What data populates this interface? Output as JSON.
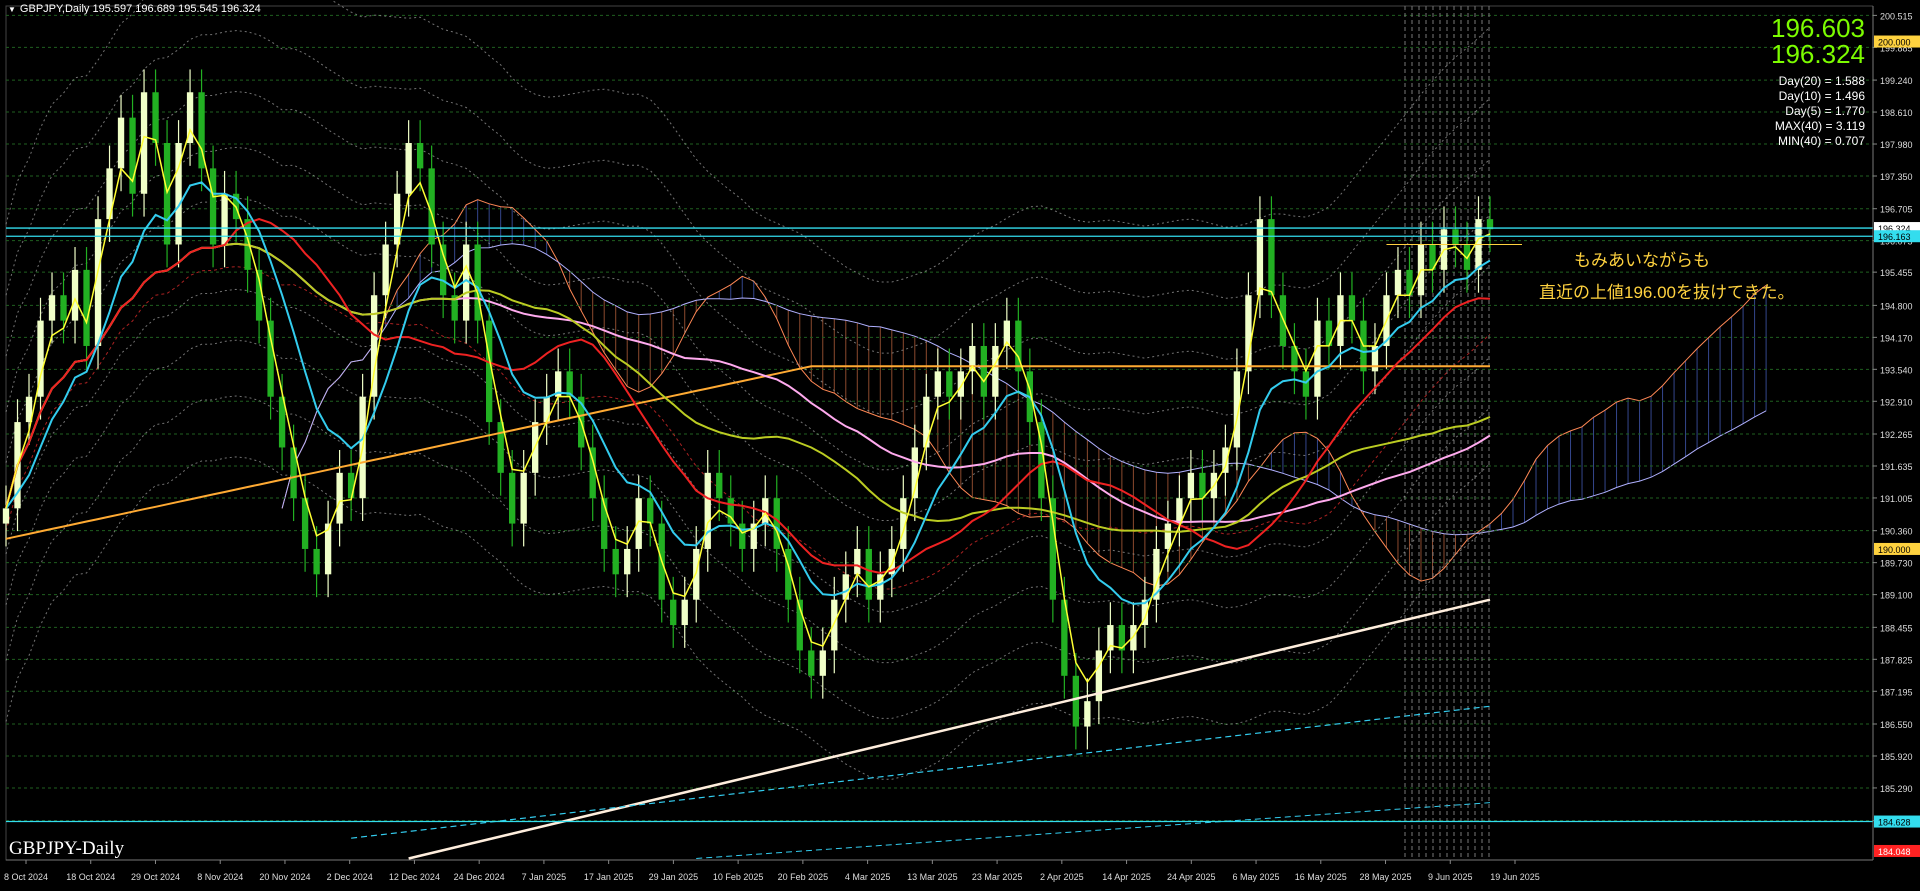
{
  "header": {
    "menu_icon": "down-triangle-icon",
    "text": "GBPJPY,Daily  195.597 196.689 195.545 196.324"
  },
  "symbol_label": "GBPJPY-Daily",
  "prices": {
    "bid": "196.603",
    "ask": "196.324"
  },
  "stats": [
    "Day(20) = 1.588",
    "Day(10) = 1.496",
    "Day(5) = 1.770",
    "MAX(40) = 3.119",
    "MIN(40) = 0.707"
  ],
  "annotation": {
    "line1": "もみあいながらも",
    "line2": "直近の上値196.00を抜けてきた。"
  },
  "colors": {
    "background": "#000000",
    "up_candle": "#F0FFC8",
    "down_candle": "#22B022",
    "ma_yellow": "#FFFF33",
    "ma_cyan": "#33CCEE",
    "ma_red": "#EE2222",
    "ma_pink": "#FFAAEE",
    "ma_olive": "#BBCC22",
    "ma_orange": "#FFAA33",
    "trendline": "#FFEEDD",
    "cloud_bull": "#6080FF",
    "cloud_bear": "#FF8855",
    "hline": "#33DDEE",
    "annotation": "#FFD23F"
  },
  "chart_data": {
    "type": "candlestick",
    "ylim": [
      183.87,
      200.7
    ],
    "x_labels": [
      "8 Oct 2024",
      "18 Oct 2024",
      "29 Oct 2024",
      "8 Nov 2024",
      "20 Nov 2024",
      "2 Dec 2024",
      "12 Dec 2024",
      "24 Dec 2024",
      "7 Jan 2025",
      "17 Jan 2025",
      "29 Jan 2025",
      "10 Feb 2025",
      "20 Feb 2025",
      "4 Mar 2025",
      "13 Mar 2025",
      "23 Mar 2025",
      "2 Apr 2025",
      "14 Apr 2025",
      "24 Apr 2025",
      "6 May 2025",
      "16 May 2025",
      "28 May 2025",
      "9 Jun 2025",
      "19 Jun 2025"
    ],
    "y_ticks": [
      "200.515",
      "199.885",
      "199.240",
      "198.610",
      "197.980",
      "197.350",
      "196.705",
      "196.075",
      "195.455",
      "194.800",
      "194.170",
      "193.540",
      "192.910",
      "192.265",
      "191.635",
      "191.005",
      "190.360",
      "189.730",
      "189.100",
      "188.455",
      "187.825",
      "187.195",
      "186.550",
      "185.920",
      "185.290",
      "184.645"
    ],
    "price_tags": [
      {
        "label": "200.000",
        "value": 200.0
      },
      {
        "label": "196.324",
        "value": 196.324
      },
      {
        "label": "196.163",
        "value": 196.163
      },
      {
        "label": "190.000",
        "value": 190.0
      },
      {
        "label": "184.628",
        "value": 184.628
      },
      {
        "label": "184.048",
        "value": 184.048
      }
    ],
    "horizontal_lines": [
      196.324,
      196.163,
      184.628
    ],
    "resistance_line": 196.0,
    "last_ohlc": {
      "open": 195.597,
      "high": 196.689,
      "low": 195.545,
      "close": 196.324
    },
    "closes": [
      190.8,
      192.5,
      193.0,
      194.5,
      195.0,
      194.5,
      195.5,
      194.0,
      196.5,
      197.5,
      198.5,
      197.0,
      199.0,
      198.0,
      196.0,
      198.0,
      199.0,
      197.5,
      196.0,
      197.0,
      196.5,
      195.5,
      194.5,
      193.0,
      192.0,
      191.0,
      190.0,
      189.5,
      190.5,
      191.5,
      191.0,
      193.0,
      195.0,
      196.0,
      197.0,
      198.0,
      197.5,
      196.0,
      195.0,
      194.5,
      196.0,
      194.5,
      192.5,
      191.5,
      190.5,
      191.5,
      192.5,
      193.0,
      193.5,
      193.0,
      192.0,
      191.0,
      190.0,
      189.5,
      190.0,
      191.0,
      190.5,
      189.0,
      188.5,
      189.0,
      190.0,
      191.5,
      191.0,
      190.5,
      190.0,
      190.5,
      191.0,
      190.0,
      189.0,
      188.0,
      187.5,
      188.0,
      189.0,
      189.5,
      190.0,
      189.0,
      189.5,
      190.0,
      191.0,
      192.0,
      193.0,
      193.5,
      193.0,
      193.5,
      194.0,
      193.0,
      194.0,
      194.5,
      193.5,
      192.5,
      191.0,
      189.0,
      187.5,
      186.5,
      187.0,
      188.0,
      188.5,
      188.0,
      188.5,
      189.0,
      190.0,
      190.5,
      191.0,
      191.5,
      191.0,
      191.5,
      192.0,
      193.5,
      195.0,
      196.5,
      195.0,
      194.0,
      193.5,
      193.0,
      194.5,
      194.0,
      195.0,
      194.5,
      193.5,
      194.0,
      195.0,
      195.5,
      195.0,
      196.0,
      195.5,
      196.3,
      196.0,
      195.5,
      196.5,
      196.3
    ]
  }
}
